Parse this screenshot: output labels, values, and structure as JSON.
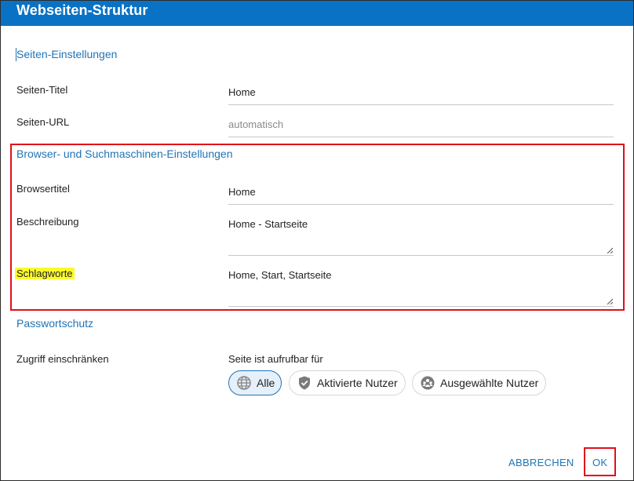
{
  "dialog": {
    "title": "Webseiten-Struktur"
  },
  "sections": {
    "page_settings": "Seiten-Einstellungen",
    "browser_seo": "Browser- und Suchmaschinen-Einstellungen",
    "password": "Passwortschutz"
  },
  "fields": {
    "page_title": {
      "label": "Seiten-Titel",
      "value": "Home"
    },
    "page_url": {
      "label": "Seiten-URL",
      "placeholder": "automatisch"
    },
    "browser_title": {
      "label": "Browsertitel",
      "value": "Home"
    },
    "description": {
      "label": "Beschreibung",
      "value": "Home - Startseite"
    },
    "keywords": {
      "label": "Schlagworte",
      "value": "Home, Start, Startseite"
    },
    "access": {
      "label": "Zugriff einschränken"
    }
  },
  "access": {
    "caption": "Seite ist aufrufbar für",
    "options": [
      {
        "label": "Alle",
        "icon": "globe-icon",
        "selected": true
      },
      {
        "label": "Aktivierte Nutzer",
        "icon": "shield-check-icon",
        "selected": false
      },
      {
        "label": "Ausgewählte Nutzer",
        "icon": "users-group-icon",
        "selected": false
      }
    ]
  },
  "actions": {
    "cancel": "ABBRECHEN",
    "ok": "OK"
  },
  "colors": {
    "titlebar": "#0a72c4",
    "accent": "#1f74b5",
    "annotation_red": "#e0101a",
    "highlight_yellow": "#fbfb2c"
  }
}
